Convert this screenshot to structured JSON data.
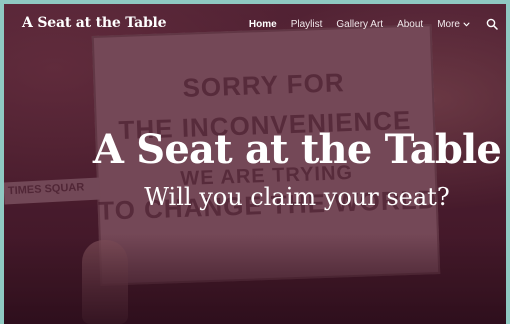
{
  "header": {
    "site_title": "A Seat at the Table"
  },
  "nav": {
    "items": [
      {
        "label": "Home",
        "active": true
      },
      {
        "label": "Playlist",
        "active": false
      },
      {
        "label": "Gallery Art",
        "active": false
      },
      {
        "label": "About",
        "active": false
      }
    ],
    "more_label": "More",
    "more_icon": "chevron-down-icon",
    "search_icon": "search-icon"
  },
  "hero": {
    "title": "A Seat at the Table",
    "subtitle": "Will you claim your seat?"
  },
  "background_sign": {
    "line1": "SORRY FOR",
    "line2": "THE INCONVENIENCE",
    "line3": "WE ARE TRYING",
    "line4": "TO CHANGE THE WORLD",
    "left_sign": "TIMES SQUAR"
  },
  "colors": {
    "frame_border": "#8fc9c2",
    "overlay_tint": "#4a1f2e",
    "text": "#ffffff"
  }
}
